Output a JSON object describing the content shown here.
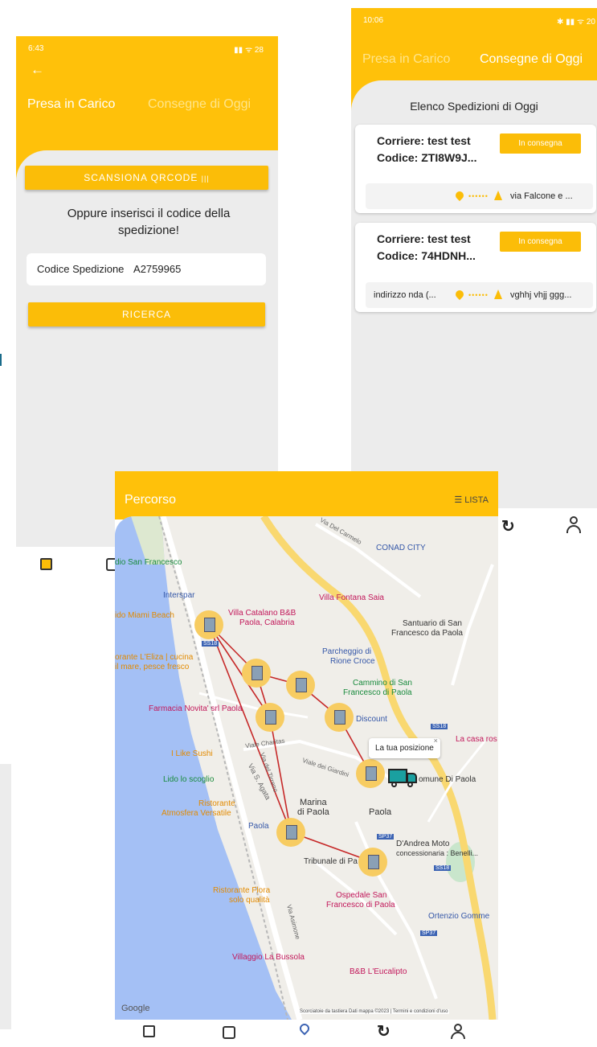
{
  "phone_left": {
    "status": {
      "time": "6:43",
      "right": "28"
    },
    "back_icon": "arrow-left-icon",
    "tabs": [
      "Presa in Carico",
      "Consegne di Oggi"
    ],
    "scan_button": "SCANSIONA QRCODE",
    "or_text": "Oppure inserisci il codice della spedizione!",
    "code_label": "Codice Spedizione",
    "code_value": "A2759965",
    "search_button": "RICERCA"
  },
  "phone_right": {
    "status": {
      "time": "10:06",
      "right": "20"
    },
    "tabs": [
      "Presa in Carico",
      "Consegne di Oggi"
    ],
    "list_title": "Elenco Spedizioni di Oggi",
    "cards": [
      {
        "courier": "Corriere: test test",
        "code": "Codice: ZTI8W9J...",
        "badge": "In consegna",
        "from": "",
        "to": "via Falcone e ..."
      },
      {
        "courier": "Corriere: test test",
        "code": "Codice: 74HDNH...",
        "badge": "In consegna",
        "from": "indirizzo nda (...",
        "to": "vghhj vhjj ggg..."
      }
    ]
  },
  "phone_map": {
    "title": "Percorso",
    "list_button": "LISTA",
    "tooltip": "La tua posizione",
    "labels": {
      "conad": "CONAD CITY",
      "san_francesco": "dio San Francesco",
      "interspar": "Interspar",
      "villa_fontana": "Villa Fontana Saia",
      "miami": "ido Miami Beach",
      "villa_catalano_1": "Villa Catalano B&B",
      "villa_catalano_2": "Paola, Calabria",
      "santuario_1": "Santuario di San",
      "santuario_2": "Francesco da Paola",
      "parcheggio_1": "Parcheggio di",
      "parcheggio_2": "Rione Croce",
      "ristorante_eliza_1": "orante L'Eliza | cucina",
      "ristorante_eliza_2": "il mare, pesce fresco",
      "cammino_1": "Cammino di San",
      "cammino_2": "Francesco di Paola",
      "farmacia": "Farmacia Novita' srl Paola",
      "discount": "Discount",
      "casa_ros": "La casa ros",
      "i_like_sushi": "I Like Sushi",
      "comune": "omune Di Paola",
      "lido_scoglio": "Lido lo scoglio",
      "ristorante_atm_1": "Ristorante",
      "ristorante_atm_2": "Atmosfera Versatile",
      "marina_1": "Marina",
      "marina_2": "di Paola",
      "paola": "Paola",
      "paola_station": "Paola",
      "dandrea_1": "D'Andrea Moto",
      "dandrea_2": "concessionaria : Benelli...",
      "tribunale": "Tribunale di Pa",
      "flora_1": "Ristorante Flora",
      "flora_2": "solo qualità",
      "ospedale_1": "Ospedale San",
      "ospedale_2": "Francesco di Paola",
      "ortenzio": "Ortenzio Gomme",
      "bussola": "Villaggio La Bussola",
      "eucalipto": "B&B L'Eucalipto",
      "via_carmelo": "Via Del Carmelo",
      "via_charitas": "Viale Charitas",
      "via_sagata": "Via S. Agata",
      "via_giardini": "Viale dei Giardini",
      "via_tirreno": "Via del Tirreno",
      "via_asimone": "Via Asimone",
      "ss18_a": "SS18",
      "ss18_b": "SS18",
      "ss18_c": "SS18",
      "sp37_a": "SP37",
      "sp37_b": "SP37",
      "google": "Google",
      "footer": "Scorciatoie da tastiera   Dati mappa ©2023  |  Termini e condizioni d'uso"
    },
    "nav_icons": [
      "package-icon",
      "wallet-icon",
      "map-pin-icon",
      "refresh-icon",
      "user-icon"
    ]
  }
}
